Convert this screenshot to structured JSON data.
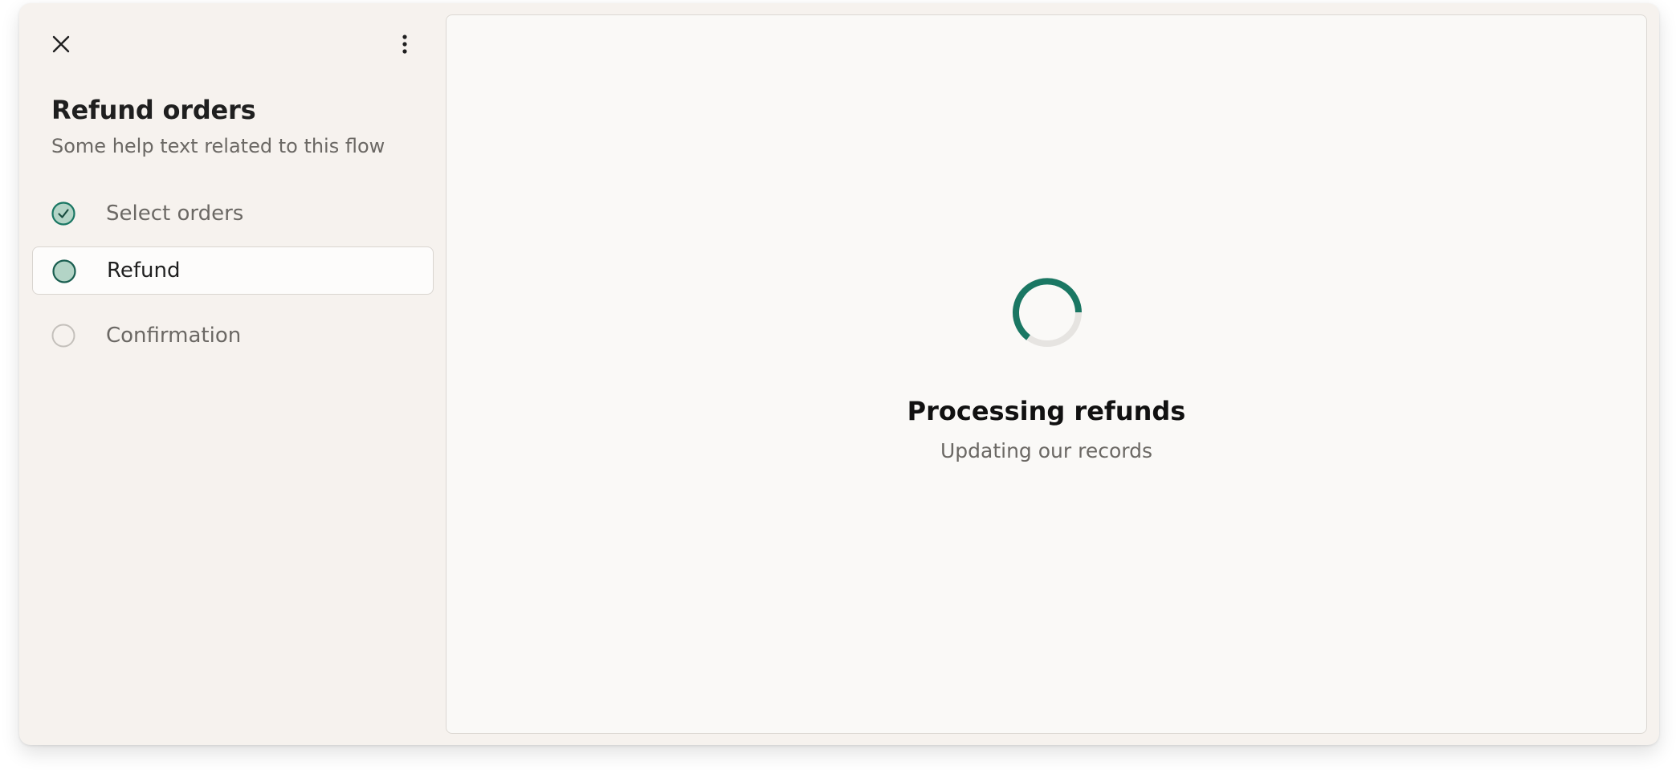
{
  "header": {
    "close_icon": "close-icon",
    "menu_icon": "more-vertical-icon",
    "title": "Refund orders",
    "subtitle": "Some help text related to this flow"
  },
  "steps": [
    {
      "label": "Select orders",
      "state": "completed"
    },
    {
      "label": "Refund",
      "state": "current"
    },
    {
      "label": "Confirmation",
      "state": "upcoming"
    }
  ],
  "main": {
    "status_title": "Processing refunds",
    "status_subtitle": "Updating our records",
    "spinner_icon": "loading-spinner-icon"
  },
  "colors": {
    "accent": "#1a7763",
    "accent_light": "#b3d4c6",
    "sidebar_bg": "#f6f2ee",
    "content_bg": "#faf9f7"
  }
}
